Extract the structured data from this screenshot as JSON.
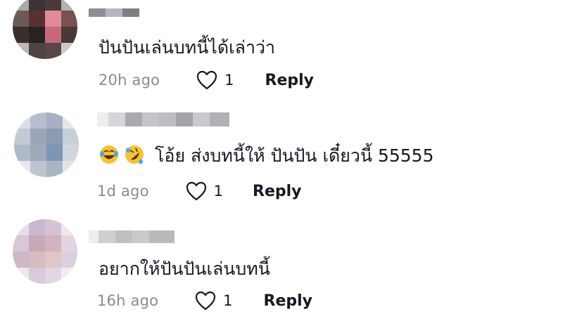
{
  "comments": [
    {
      "text": "ปันปันเล่นบทนี้ได้เล่าว่า",
      "time": "20h ago",
      "likes": "1",
      "reply_label": "Reply",
      "emojis": [],
      "avatar_colors": [
        "#a9a9a9",
        "#3c3434",
        "#4a3a3a",
        "#b8b0b0",
        "#6b5a5a",
        "#5c3030",
        "#e08a9a",
        "#7a5050",
        "#3a2e2e",
        "#2a2222",
        "#c46a7a",
        "#4a3838",
        "#c0b8b8",
        "#4e4444",
        "#5a4646",
        "#cfc9c9"
      ]
    },
    {
      "text": "โอ้ย ส่งบทนี้ให้ ปันปัน เดี๋ยวนี้ 55555",
      "time": "1d ago",
      "likes": "1",
      "reply_label": "Reply",
      "emojis": [
        "face-with-tears-of-joy",
        "rolling-on-the-floor-laughing"
      ],
      "avatar_colors": [
        "#d8dde8",
        "#b7bfcc",
        "#a5b0c2",
        "#e4e7ee",
        "#c3cad6",
        "#9aa6ba",
        "#8c9ab3",
        "#c9cfda",
        "#b0b9c9",
        "#a0aabb",
        "#7f95b8",
        "#d0d5df",
        "#e6e9ef",
        "#bcc4d1",
        "#aab4c5",
        "#e1e4ea"
      ]
    },
    {
      "text": "อยากให้ปันปันเล่นบทนี้",
      "time": "16h ago",
      "likes": "1",
      "reply_label": "Reply",
      "emojis": [],
      "avatar_colors": [
        "#e8dce6",
        "#cbb7cf",
        "#d6c2d4",
        "#efe6ee",
        "#d9c6d6",
        "#c8a9b8",
        "#d2b3bf",
        "#e3d4e0",
        "#cdb8c8",
        "#d7bcc0",
        "#e0c7c6",
        "#dccfe0",
        "#eee7ef",
        "#d8cade",
        "#e2d6e4",
        "#f1ecf2"
      ]
    }
  ],
  "colors": {
    "text": "#161823",
    "muted": "#8a8b91",
    "blur_light": "#d0d0d4",
    "blur_dark": "#9c9ca3"
  }
}
